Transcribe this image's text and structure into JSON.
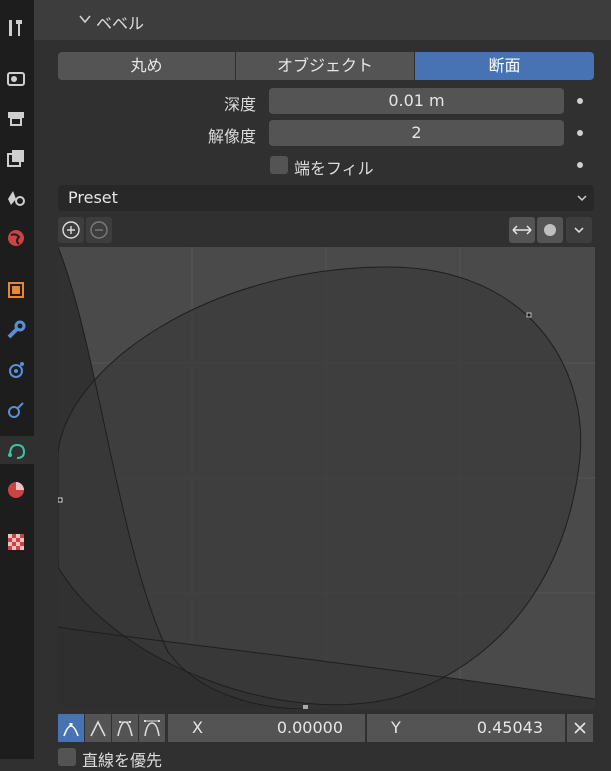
{
  "panel": {
    "title": "ベベル"
  },
  "tabs": [
    {
      "label": "丸め",
      "active": false
    },
    {
      "label": "オブジェクト",
      "active": false
    },
    {
      "label": "断面",
      "active": true
    }
  ],
  "fields": {
    "depth": {
      "label": "深度",
      "value": "0.01 m"
    },
    "resolution": {
      "label": "解像度",
      "value": "2"
    },
    "fill_caps": {
      "label": "端をフィル",
      "checked": false
    }
  },
  "preset": {
    "label": "Preset"
  },
  "curve": {
    "coord_x": {
      "label": "X",
      "value": "0.00000"
    },
    "coord_y": {
      "label": "Y",
      "value": "0.45043"
    }
  },
  "footer": {
    "cut_label": "直線を優先"
  },
  "colors": {
    "accent": "#4772b3",
    "bg": "#303030",
    "header": "#3d3d3d",
    "sidebar": "#1d1d1d",
    "field": "#545454"
  },
  "sidebar_icons": [
    "tool-icon",
    "render-icon",
    "output-icon",
    "view-layer-icon",
    "scene-icon",
    "world-icon",
    "object-icon",
    "modifier-icon",
    "particles-icon",
    "physics-icon",
    "object-data-curve-icon",
    "material-icon",
    "texture-icon"
  ]
}
